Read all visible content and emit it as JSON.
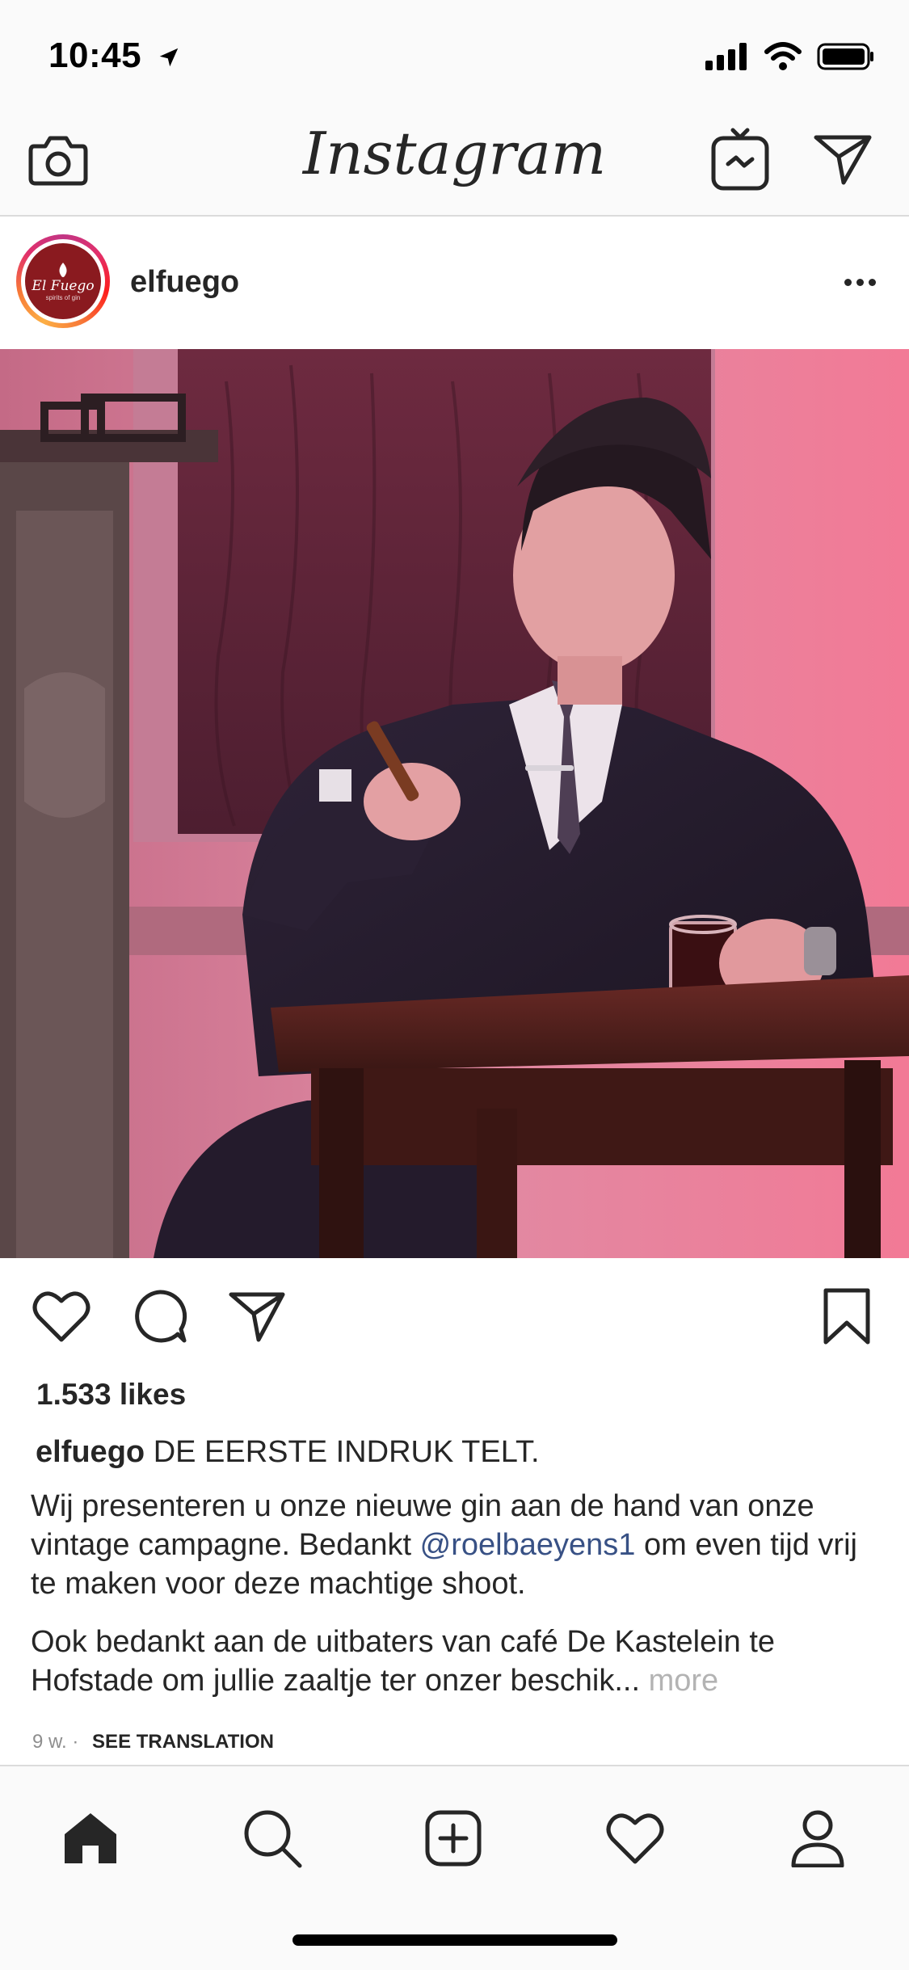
{
  "status": {
    "time": "10:45"
  },
  "header": {
    "title": "Instagram",
    "icons": [
      "camera-icon",
      "igtv-icon",
      "direct-icon"
    ]
  },
  "post": {
    "username": "elfuego",
    "avatar_text": "El Fuego",
    "avatar_subtext": "spirits of gin",
    "likes": "1.533 likes",
    "caption_user": "elfuego",
    "caption_headline": "DE EERSTE INDRUK TELT.",
    "para1_a": "Wij presenteren u onze nieuwe gin aan de hand van onze vintage campagne. Bedankt ",
    "para1_mention": "@roelbaeyens1",
    "para1_b": " om even tijd vrij te maken voor deze machtige shoot.",
    "para2": "Ook bedankt aan de uitbaters van café De Kastelein te Hofstade om jullie zaaltje ter onzer beschik... ",
    "more": "more",
    "time_ago": "9 w.",
    "separator": "·",
    "see_translation": "SEE TRANSLATION"
  },
  "colors": {
    "accent_link": "#385185",
    "text": "#262626",
    "muted": "#8e8e8e",
    "brand_red": "#8a1a1f"
  },
  "tabbar": {
    "icons": [
      "home-icon",
      "search-icon",
      "add-post-icon",
      "activity-heart-icon",
      "profile-icon"
    ]
  }
}
